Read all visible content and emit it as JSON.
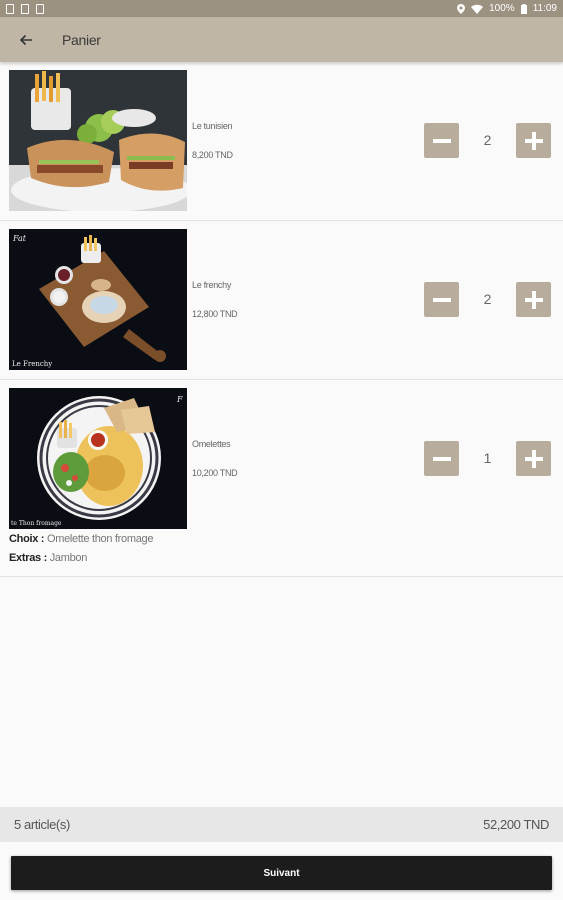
{
  "status_bar": {
    "battery": "100%",
    "time": "11:09"
  },
  "app_bar": {
    "title": "Panier"
  },
  "cart": {
    "items": [
      {
        "name": "Le tunisien",
        "price": "8,200 TND",
        "quantity": "2"
      },
      {
        "name": "Le frenchy",
        "price": "12,800 TND",
        "quantity": "2"
      },
      {
        "name": "Omelettes",
        "price": "10,200 TND",
        "quantity": "1",
        "choice_label": "Choix :",
        "choice_value": "Omelette thon fromage",
        "extras_label": "Extras :",
        "extras_value": "Jambon"
      }
    ]
  },
  "summary": {
    "count": "5 article(s)",
    "total": "52,200 TND"
  },
  "footer": {
    "next_label": "Suivant"
  },
  "colors": {
    "status_bar": "#9c9281",
    "app_bar": "#bfb6a5",
    "qty_button": "#b8ad9c",
    "next_button": "#1c1c1c",
    "summary_bar": "#e7e7e7"
  },
  "icons": {
    "back": "arrow-left",
    "minus": "minus",
    "plus": "plus"
  }
}
